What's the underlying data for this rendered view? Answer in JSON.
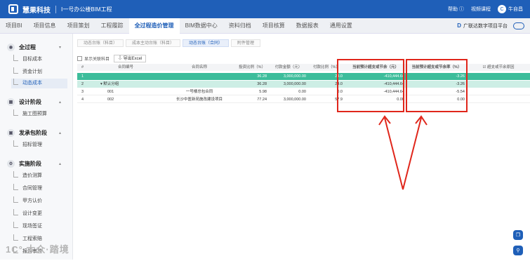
{
  "topbar": {
    "brand": "慧果科技",
    "project": "Ⅰ一号办公楼BIM工程",
    "help": "帮助 ⓘ",
    "video": "视频课程",
    "avatar": "C",
    "user": "牛自昌"
  },
  "nav": {
    "items": [
      "项目BI",
      "项目信息",
      "项目策划",
      "工程履踪",
      "全过程造价管理",
      "BIM数据中心",
      "资料归档",
      "项目核算",
      "数据报表",
      "通用设置"
    ],
    "active_index": 4,
    "platform": "广联达数字项目平台"
  },
  "sidebar": {
    "sections": [
      {
        "title": "全过程",
        "chevron": "▾",
        "items": [
          "目标成本",
          "资金计划",
          "动态成本"
        ]
      },
      {
        "title": "设计阶段",
        "chevron": "▴",
        "items": [
          "施工图预算"
        ]
      },
      {
        "title": "发承包阶段",
        "chevron": "▴",
        "items": [
          "招标管理"
        ]
      },
      {
        "title": "实施阶段",
        "chevron": "▴",
        "items": [
          "造价测算",
          "合同管理",
          "甲方认价",
          "设计变更",
          "现场签证",
          "工程索赔",
          "报告审核"
        ]
      }
    ],
    "active_item": "动态成本"
  },
  "pills": [
    "动态台账（科目）",
    "成本主动台账（科目）",
    "动态台账（合同）",
    "附件管理"
  ],
  "pill_active": 2,
  "toolbar": {
    "checkbox_label": "显示关联科目",
    "export_label": "⇩ 导出Excel"
  },
  "table": {
    "headers": [
      "#",
      "合同编号",
      "合同名称",
      "投资比例（%）",
      "付款金额（元）",
      "付款比例（%）",
      "当前预计超支或节余（元）",
      "当前预计超支或节余率（%）",
      "☑ 超支或节余原因"
    ],
    "rows": [
      [
        "1",
        "",
        "",
        "36.28",
        "3,000,000.00",
        "24.0",
        "-410,444.64",
        "-3.26",
        ""
      ],
      [
        "2",
        "▾ 默认分组",
        "",
        "36.28",
        "3,000,000.00",
        "24.0",
        "-410,444.64",
        "-3.26",
        ""
      ],
      [
        "3",
        "001",
        "一号楼总包合同",
        "5.98",
        "0.00",
        "0.0",
        "-410,444.64",
        "-5.54",
        ""
      ],
      [
        "4",
        "002",
        "长沙中医新苑施改建设项目",
        "77.24",
        "3,000,000.00",
        "57.9",
        "0.00",
        "0.00",
        ""
      ]
    ]
  },
  "fabs": [
    "❐",
    "⚲"
  ],
  "watermark": "1C° 大众·踏境"
}
